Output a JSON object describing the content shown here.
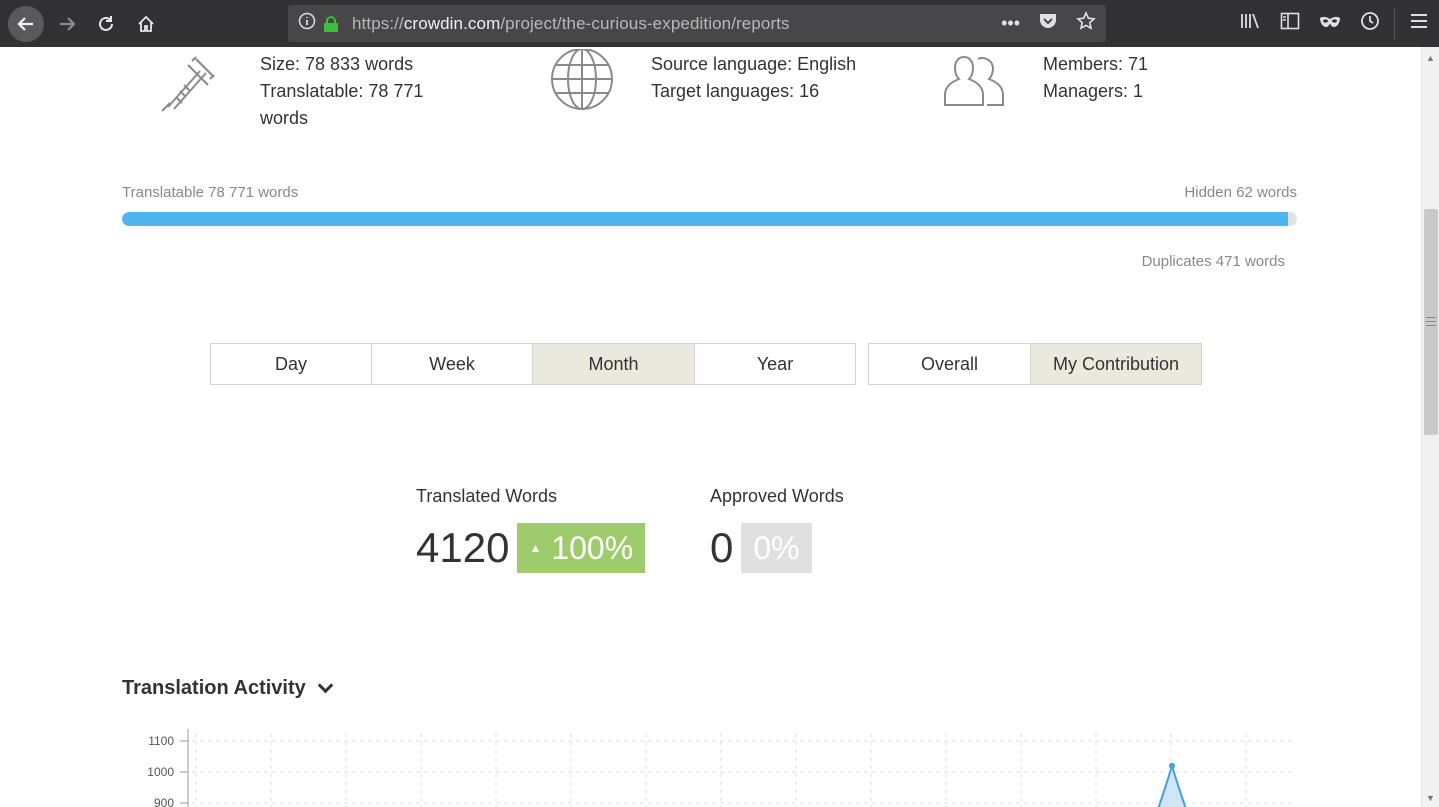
{
  "browser": {
    "url_prefix": "https://",
    "url_domain": "crowdin.com",
    "url_path": "/project/the-curious-expedition/reports"
  },
  "info": {
    "size_line1": "Size: 78 833 words",
    "size_line2": "Translatable: 78 771",
    "size_line3": "words",
    "lang_line1": "Source language: English",
    "lang_line2": "Target languages: 16",
    "members_line1": "Members: 71",
    "members_line2": "Managers: 1"
  },
  "progress": {
    "left_label": "Translatable 78 771 words",
    "right_label": "Hidden 62 words",
    "duplicates_label": "Duplicates 471 words",
    "fill_percent": 99.2,
    "fill_color": "#4db6f1"
  },
  "period_tabs": [
    {
      "label": "Day",
      "active": false
    },
    {
      "label": "Week",
      "active": false
    },
    {
      "label": "Month",
      "active": true
    },
    {
      "label": "Year",
      "active": false
    }
  ],
  "scope_tabs": [
    {
      "label": "Overall",
      "active": false
    },
    {
      "label": "My Contribution",
      "active": true
    }
  ],
  "stats": {
    "translated_label": "Translated Words",
    "translated_value": "4120",
    "translated_change": "100%",
    "approved_label": "Approved Words",
    "approved_value": "0",
    "approved_change": "0%"
  },
  "activity": {
    "title": "Translation Activity"
  },
  "chart_data": {
    "type": "area",
    "ytick_labels": [
      "1100",
      "1000",
      "900"
    ],
    "peak_value": 1020,
    "ylim_visible": [
      900,
      1100
    ]
  }
}
